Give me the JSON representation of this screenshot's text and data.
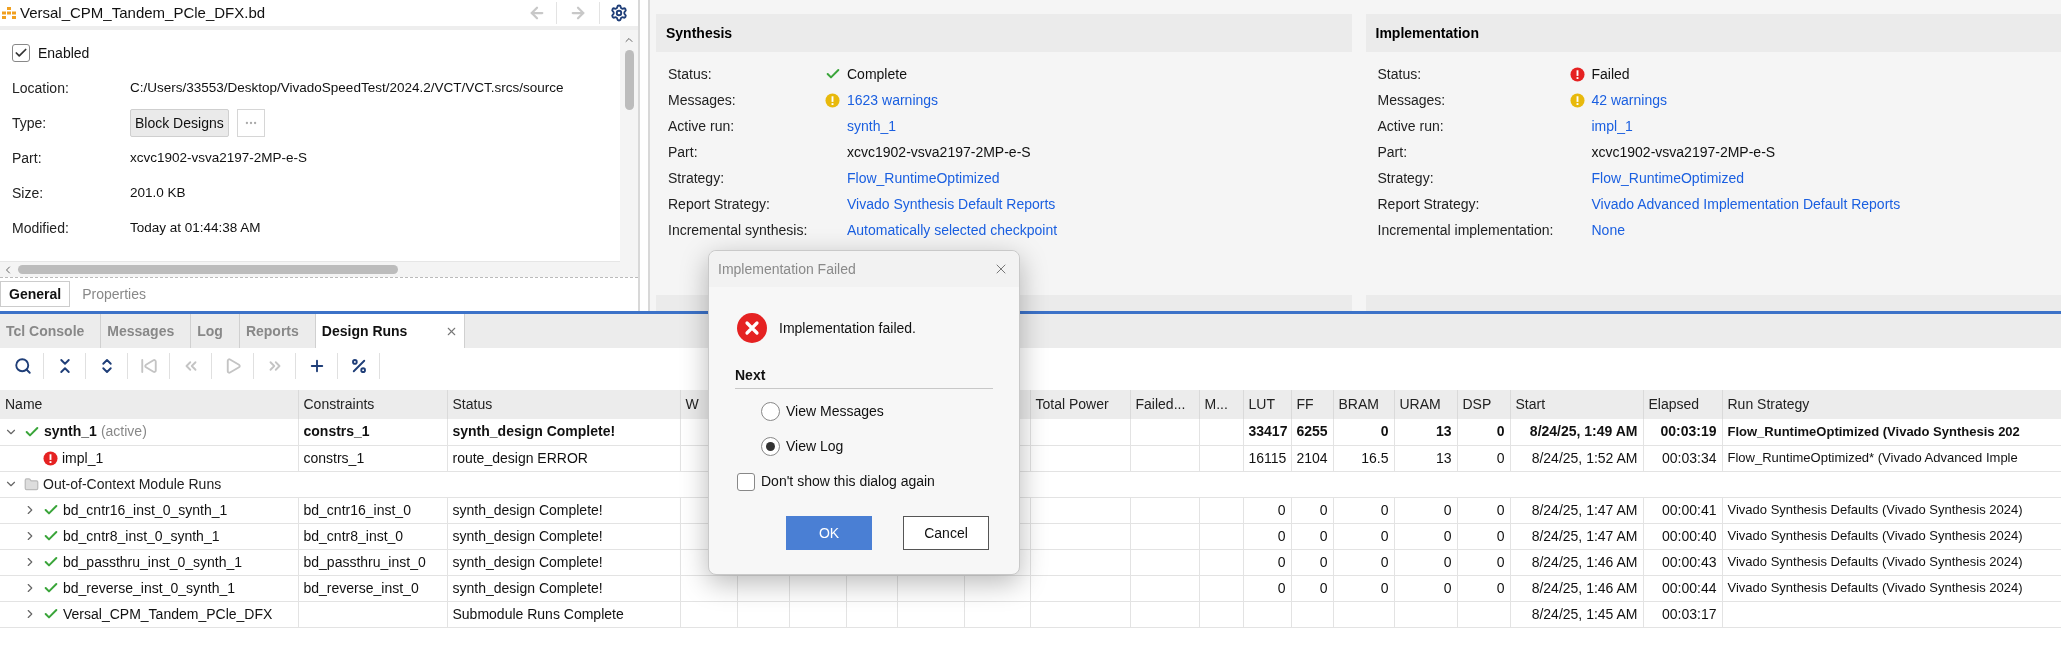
{
  "file_panel": {
    "title": "Versal_CPM_Tandem_PCle_DFX.bd",
    "back_disabled": true,
    "forward_disabled": true,
    "enabled": {
      "label": "Enabled",
      "checked": true
    },
    "fields": [
      {
        "label": "Location:",
        "kind": "text",
        "value": "C:/Users/33553/Desktop/VivadoSpeedTest/2024.2/VCT/VCT.srcs/source"
      },
      {
        "label": "Type:",
        "kind": "button",
        "value": "Block Designs"
      },
      {
        "label": "Part:",
        "kind": "text",
        "value": "xcvc1902-vsva2197-2MP-e-S"
      },
      {
        "label": "Size:",
        "kind": "text",
        "value": "201.0 KB"
      },
      {
        "label": "Modified:",
        "kind": "text",
        "value": "Today at 01:44:38 AM"
      }
    ],
    "tabs": [
      {
        "label": "General",
        "selected": true
      },
      {
        "label": "Properties",
        "selected": false
      }
    ]
  },
  "synthesis": {
    "title": "Synthesis",
    "rows": [
      {
        "label": "Status:",
        "value": "Complete",
        "kind": "ok",
        "link": false
      },
      {
        "label": "Messages:",
        "value": "1623 warnings",
        "kind": "warning",
        "link": true
      },
      {
        "label": "Active run:",
        "value": "synth_1",
        "kind": "plain",
        "link": true
      },
      {
        "label": "Part:",
        "value": "xcvc1902-vsva2197-2MP-e-S",
        "kind": "plain",
        "link": false
      },
      {
        "label": "Strategy:",
        "value": "Flow_RuntimeOptimized",
        "kind": "plain",
        "link": true
      },
      {
        "label": "Report Strategy:",
        "value": "Vivado Synthesis Default Reports",
        "kind": "plain",
        "link": true
      },
      {
        "label": "Incremental synthesis:",
        "value": "Automatically selected checkpoint",
        "kind": "plain",
        "link": true
      }
    ]
  },
  "implementation": {
    "title": "Implementation",
    "rows": [
      {
        "label": "Status:",
        "value": "Failed",
        "kind": "failed",
        "link": false
      },
      {
        "label": "Messages:",
        "value": "42 warnings",
        "kind": "warning",
        "link": true
      },
      {
        "label": "Active run:",
        "value": "impl_1",
        "kind": "plain",
        "link": true
      },
      {
        "label": "Part:",
        "value": "xcvc1902-vsva2197-2MP-e-S",
        "kind": "plain",
        "link": false
      },
      {
        "label": "Strategy:",
        "value": "Flow_RuntimeOptimized",
        "kind": "plain",
        "link": true
      },
      {
        "label": "Report Strategy:",
        "value": "Vivado Advanced Implementation Default Reports",
        "kind": "plain",
        "link": true
      },
      {
        "label": "Incremental implementation:",
        "value": "None",
        "kind": "plain",
        "link": true
      }
    ]
  },
  "bottom_tabs": [
    {
      "label": "Tcl Console",
      "selected": false,
      "closable": false
    },
    {
      "label": "Messages",
      "selected": false,
      "closable": false
    },
    {
      "label": "Log",
      "selected": false,
      "closable": false
    },
    {
      "label": "Reports",
      "selected": false,
      "closable": false
    },
    {
      "label": "Design Runs",
      "selected": true,
      "closable": true
    }
  ],
  "toolbar": [
    {
      "kind": "search",
      "disabled": false
    },
    {
      "kind": "collapse_all",
      "disabled": false
    },
    {
      "kind": "expand_all",
      "disabled": false
    },
    {
      "kind": "first",
      "disabled": true
    },
    {
      "kind": "previous",
      "disabled": true
    },
    {
      "kind": "run",
      "disabled": true
    },
    {
      "kind": "next",
      "disabled": true
    },
    {
      "kind": "add",
      "disabled": false
    },
    {
      "kind": "percent",
      "disabled": false
    }
  ],
  "columns": {
    "name": "Name",
    "constraints": "Constraints",
    "status": "Status",
    "column_4": "W",
    "total_power": "Total Power",
    "column_10": "Failed...",
    "column_11": "M...",
    "lut": "LUT",
    "ff": "FF",
    "bram": "BRAM",
    "uram": "URAM",
    "dsp": "DSP",
    "start": "Start",
    "elapsed": "Elapsed",
    "run_strategy": "Run Strategy"
  },
  "runs": [
    {
      "kind": "run",
      "name": "synth_1",
      "active": true,
      "active_label": "(active)",
      "failed": false,
      "expanded": true,
      "constraints": "constrs_1",
      "status": "synth_design Complete!",
      "lut": "33417",
      "ff": "6255",
      "bram": "0",
      "uram": "13",
      "dsp": "0",
      "start": "8/24/25, 1:49 AM",
      "elapsed": "00:03:19",
      "run_strategy": "Flow_RuntimeOptimized (Vivado Synthesis 202",
      "children": [
        {
          "kind": "run",
          "name": "impl_1",
          "active": false,
          "failed": true,
          "constraints": "constrs_1",
          "status": "route_design ERROR",
          "lut": "16115",
          "ff": "2104",
          "bram": "16.5",
          "uram": "13",
          "dsp": "0",
          "start": "8/24/25, 1:52 AM",
          "elapsed": "00:03:34",
          "run_strategy": "Flow_RuntimeOptimized* (Vivado Advanced Imple"
        }
      ]
    },
    {
      "kind": "group",
      "name": "Out-of-Context Module Runs",
      "expanded": true,
      "children": [
        {
          "kind": "run",
          "name": "bd_cntr16_inst_0_synth_1",
          "active": false,
          "failed": false,
          "expanded": false,
          "constraints": "bd_cntr16_inst_0",
          "status": "synth_design Complete!",
          "lut": "0",
          "ff": "0",
          "bram": "0",
          "uram": "0",
          "dsp": "0",
          "start": "8/24/25, 1:47 AM",
          "elapsed": "00:00:41",
          "run_strategy": "Vivado Synthesis Defaults (Vivado Synthesis 2024)"
        },
        {
          "kind": "run",
          "name": "bd_cntr8_inst_0_synth_1",
          "active": false,
          "failed": false,
          "expanded": false,
          "constraints": "bd_cntr8_inst_0",
          "status": "synth_design Complete!",
          "lut": "0",
          "ff": "0",
          "bram": "0",
          "uram": "0",
          "dsp": "0",
          "start": "8/24/25, 1:47 AM",
          "elapsed": "00:00:40",
          "run_strategy": "Vivado Synthesis Defaults (Vivado Synthesis 2024)"
        },
        {
          "kind": "run",
          "name": "bd_passthru_inst_0_synth_1",
          "active": false,
          "failed": false,
          "expanded": false,
          "constraints": "bd_passthru_inst_0",
          "status": "synth_design Complete!",
          "lut": "0",
          "ff": "0",
          "bram": "0",
          "uram": "0",
          "dsp": "0",
          "start": "8/24/25, 1:46 AM",
          "elapsed": "00:00:43",
          "run_strategy": "Vivado Synthesis Defaults (Vivado Synthesis 2024)"
        },
        {
          "kind": "run",
          "name": "bd_reverse_inst_0_synth_1",
          "active": false,
          "failed": false,
          "expanded": false,
          "constraints": "bd_reverse_inst_0",
          "status": "synth_design Complete!",
          "lut": "0",
          "ff": "0",
          "bram": "0",
          "uram": "0",
          "dsp": "0",
          "start": "8/24/25, 1:46 AM",
          "elapsed": "00:00:44",
          "run_strategy": "Vivado Synthesis Defaults (Vivado Synthesis 2024)"
        },
        {
          "kind": "run",
          "name": "Versal_CPM_Tandem_PCle_DFX",
          "active": false,
          "failed": false,
          "expanded": false,
          "status": "Submodule Runs Complete",
          "start": "8/24/25, 1:45 AM",
          "elapsed": "00:03:17"
        }
      ]
    }
  ],
  "dialog": {
    "title": "Implementation Failed",
    "message": "Implementation failed.",
    "section": "Next",
    "options": [
      {
        "label": "View Messages",
        "selected": false
      },
      {
        "label": "View Log",
        "selected": true
      }
    ],
    "dont_show": {
      "label": "Don't show this dialog again",
      "checked": false
    },
    "buttons": [
      {
        "label": "OK",
        "kind": "primary"
      },
      {
        "label": "Cancel",
        "kind": "secondary"
      }
    ]
  }
}
